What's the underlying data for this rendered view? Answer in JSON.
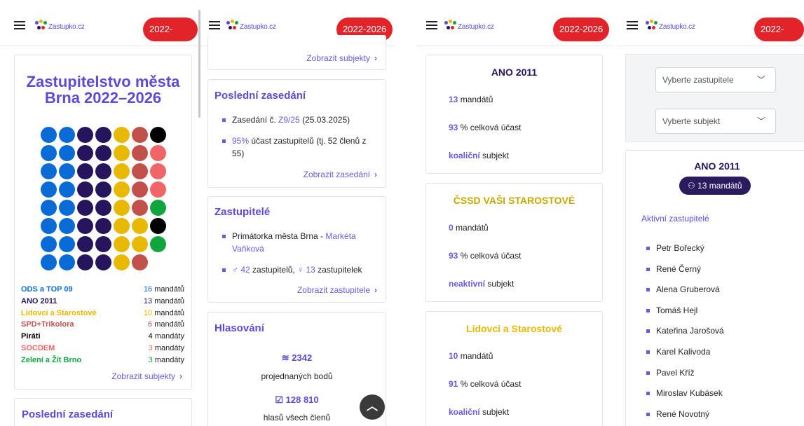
{
  "header": {
    "logo_text": "Zastupko.cz",
    "term": "2022-2026"
  },
  "panel1": {
    "title_line1": "Zastupitelstvo města",
    "title_line2": "Brna 2022–2026",
    "parties": [
      {
        "name": "ODS a TOP 09",
        "count": "16",
        "unit": "mandátů",
        "color": "#0a6bd6",
        "count_color": "#0a6bd6"
      },
      {
        "name": "ANO 2011",
        "count": "13",
        "unit": "mandátů",
        "color": "#26145c",
        "count_color": "#26145c"
      },
      {
        "name": "Lidovci a Starostové",
        "count": "10",
        "unit": "mandátů",
        "color": "#e9b800",
        "count_color": "#e9b800"
      },
      {
        "name": "SPD+Trikolora",
        "count": "6",
        "unit": "mandátů",
        "color": "#c2514c",
        "count_color": "#c2514c"
      },
      {
        "name": "Piráti",
        "count": "4",
        "unit": "mandáty",
        "color": "#000000",
        "count_color": "#000000"
      },
      {
        "name": "SOCDEM",
        "count": "3",
        "unit": "mandáty",
        "color": "#f06565",
        "count_color": "#f06565"
      },
      {
        "name": "Zelení a Žít Brno",
        "count": "3",
        "unit": "mandáty",
        "color": "#10a53f",
        "count_color": "#10a53f"
      }
    ],
    "show_subjects": "Zobrazit subjekty",
    "last_session_title": "Poslední zasedání"
  },
  "panel2": {
    "show_subjects": "Zobrazit subjekty",
    "last_session": {
      "title": "Poslední zasedání",
      "session_prefix": "Zasedání č. ",
      "session_id": "Z9/25",
      "session_date": " (25.03.2025)",
      "attendance_pct": "95%",
      "attendance_text": " účast zastupitelů (tj. 52 členů z 55)",
      "link": "Zobrazit zasedání"
    },
    "representatives": {
      "title": "Zastupitelé",
      "mayor_prefix": "Primátorka města Brna - ",
      "mayor_name": "Markéta Vaňková",
      "male_count": "42",
      "male_label": "zastupitelů,",
      "female_count": "13",
      "female_label": "zastupitelek",
      "link": "Zobrazit zastupitele"
    },
    "voting": {
      "title": "Hlasování",
      "items_count": "2342",
      "items_label": "projednaných bodů",
      "votes_count": "128 810",
      "votes_label": "hlasů všech členů"
    }
  },
  "panel3": {
    "cards": [
      {
        "name": "ANO 2011",
        "name_color": "#26145c",
        "mandates_num": "13",
        "mandates_label": " mandátů",
        "attendance_num": "93",
        "attendance_label": " % celková účast",
        "status_word": "koaliční",
        "status_label": " subjekt"
      },
      {
        "name": "ČSSD VAŠI STAROSTOVÉ",
        "name_color": "#c9a800",
        "mandates_num": "0",
        "mandates_label": " mandátů",
        "attendance_num": "93",
        "attendance_label": " % celková účast",
        "status_word": "neaktivní",
        "status_label": " subjekt"
      },
      {
        "name": "Lidovci a Starostové",
        "name_color": "#e9b800",
        "mandates_num": "10",
        "mandates_label": " mandátů",
        "attendance_num": "91",
        "attendance_label": " % celková účast",
        "status_word": "koaliční",
        "status_label": " subjekt"
      }
    ]
  },
  "panel4": {
    "select_rep_placeholder": "Vyberte zastupitele",
    "select_subject_placeholder": "Vyberte subjekt",
    "party_name": "ANO 2011",
    "mandates_badge": "13 mandátů",
    "active_title": "Aktivní zastupitelé",
    "members": [
      "Petr Bořecký",
      "René Černý",
      "Alena Gruberová",
      "Tomáš Hejl",
      "Kateřina Jarošová",
      "Karel Kalivoda",
      "Pavel Kříž",
      "Miroslav Kubásek",
      "René Novotný"
    ]
  }
}
